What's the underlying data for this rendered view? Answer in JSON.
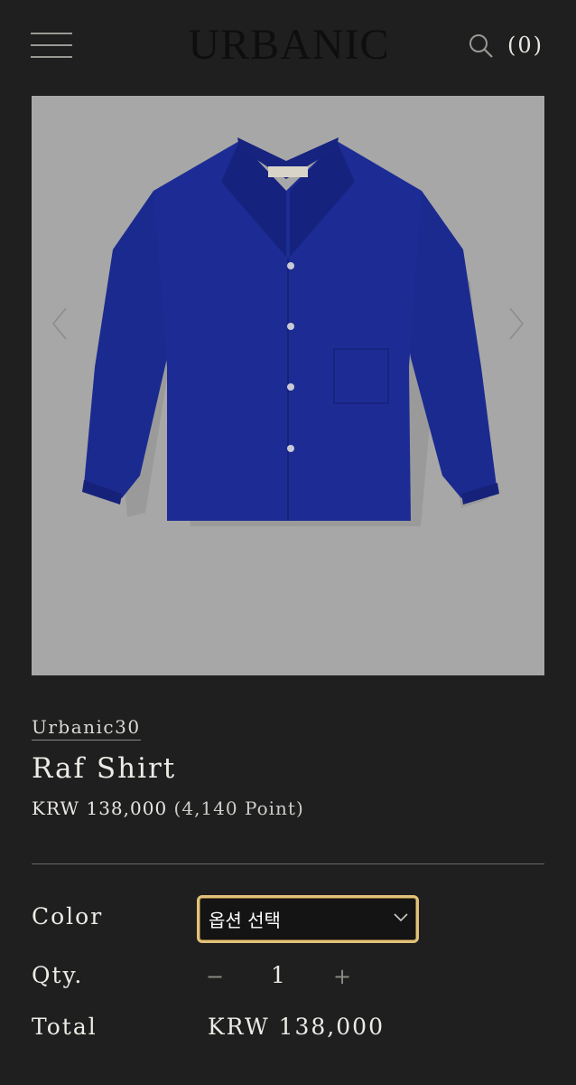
{
  "header": {
    "logo": "URBANIC",
    "cart_count": "(0)"
  },
  "product": {
    "brand": "Urbanic30",
    "name": "Raf Shirt",
    "price": "KRW 138,000",
    "points": "(4,140 Point)"
  },
  "options": {
    "color_label": "Color",
    "color_selected": "옵션 선택",
    "qty_label": "Qty.",
    "qty_value": "1",
    "qty_minus": "−",
    "qty_plus": "+",
    "total_label": "Total",
    "total_value": "KRW 138,000"
  },
  "icons": {
    "menu": "hamburger-icon",
    "search": "search-icon",
    "prev": "chevron-left-icon",
    "next": "chevron-right-icon",
    "dropdown": "chevron-down-icon"
  },
  "colors": {
    "background": "#1f1f1f",
    "image_bg": "#a7a7a7",
    "shirt": "#1b2a8f",
    "select_border": "#e2c27a"
  }
}
